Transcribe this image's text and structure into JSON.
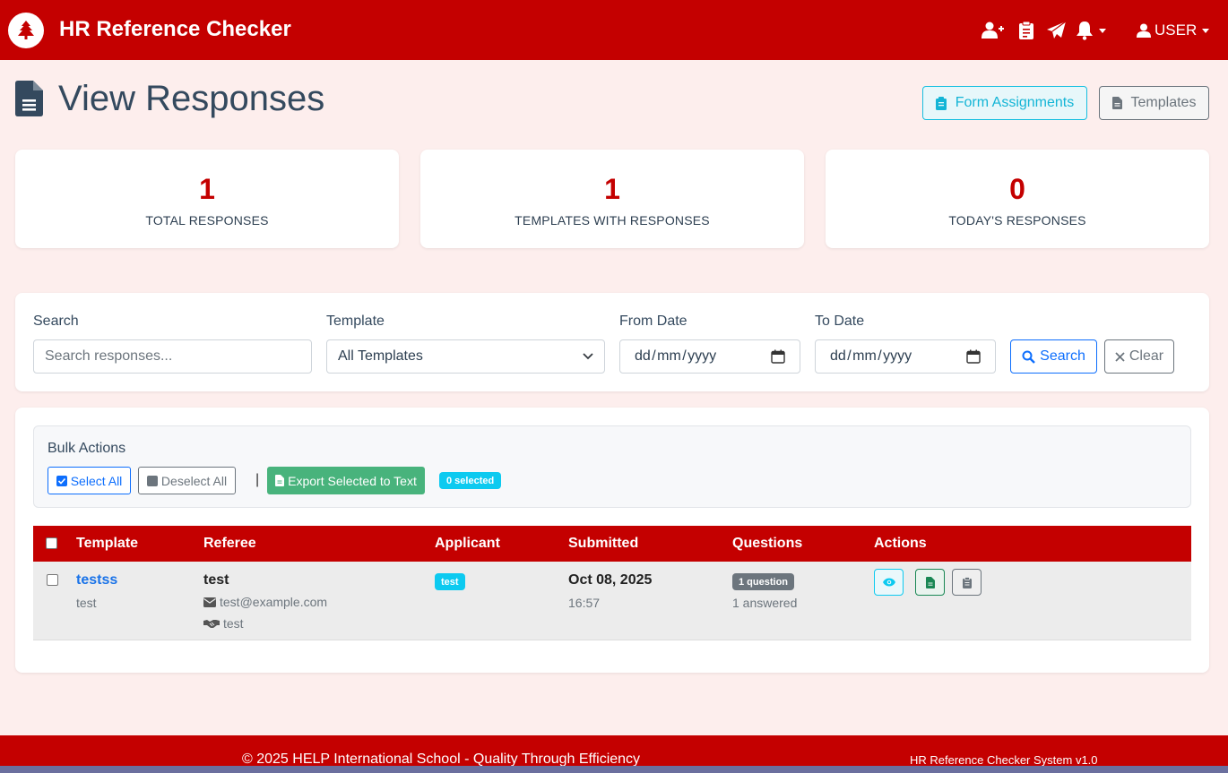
{
  "navbar": {
    "brand": "HR Reference Checker",
    "user_label": "USER",
    "icons": [
      "user-plus-icon",
      "clipboard-icon",
      "paper-plane-icon",
      "bell-icon",
      "user-icon"
    ]
  },
  "header": {
    "title": "View Responses",
    "form_assignments_label": "Form Assignments",
    "templates_label": "Templates"
  },
  "stats": [
    {
      "value": "1",
      "label": "TOTAL RESPONSES"
    },
    {
      "value": "1",
      "label": "TEMPLATES WITH RESPONSES"
    },
    {
      "value": "0",
      "label": "TODAY'S RESPONSES"
    }
  ],
  "filters": {
    "search_label": "Search",
    "search_placeholder": "Search responses...",
    "template_label": "Template",
    "template_value": "All Templates",
    "from_label": "From Date",
    "from_placeholder": "dd / mm / yyyy",
    "to_label": "To Date",
    "to_placeholder": "dd / mm / yyyy",
    "search_button": "Search",
    "clear_button": "Clear"
  },
  "bulk": {
    "title": "Bulk Actions",
    "select_all": "Select All",
    "deselect_all": "Deselect All",
    "separator": "|",
    "export": "Export Selected to Text",
    "selected_badge": "0 selected"
  },
  "table": {
    "columns": [
      "Template",
      "Referee",
      "Applicant",
      "Submitted",
      "Questions",
      "Actions"
    ],
    "rows": [
      {
        "template": "testss",
        "template_sub": "test",
        "referee_name": "test",
        "referee_email": "test@example.com",
        "referee_relation": "test",
        "applicant": "test",
        "submitted_date": "Oct 08, 2025",
        "submitted_time": "16:57",
        "questions_badge": "1 question",
        "questions_answered": "1 answered"
      }
    ]
  },
  "footer": {
    "left": "© 2025 HELP International School - Quality Through Efficiency",
    "right": "HR Reference Checker System v1.0"
  },
  "colors": {
    "brand_red": "#c40000",
    "info": "#0dcaf0",
    "primary": "#0d6efd",
    "success": "#48b37c",
    "secondary": "#6c757d",
    "background": "#fdeeed"
  }
}
